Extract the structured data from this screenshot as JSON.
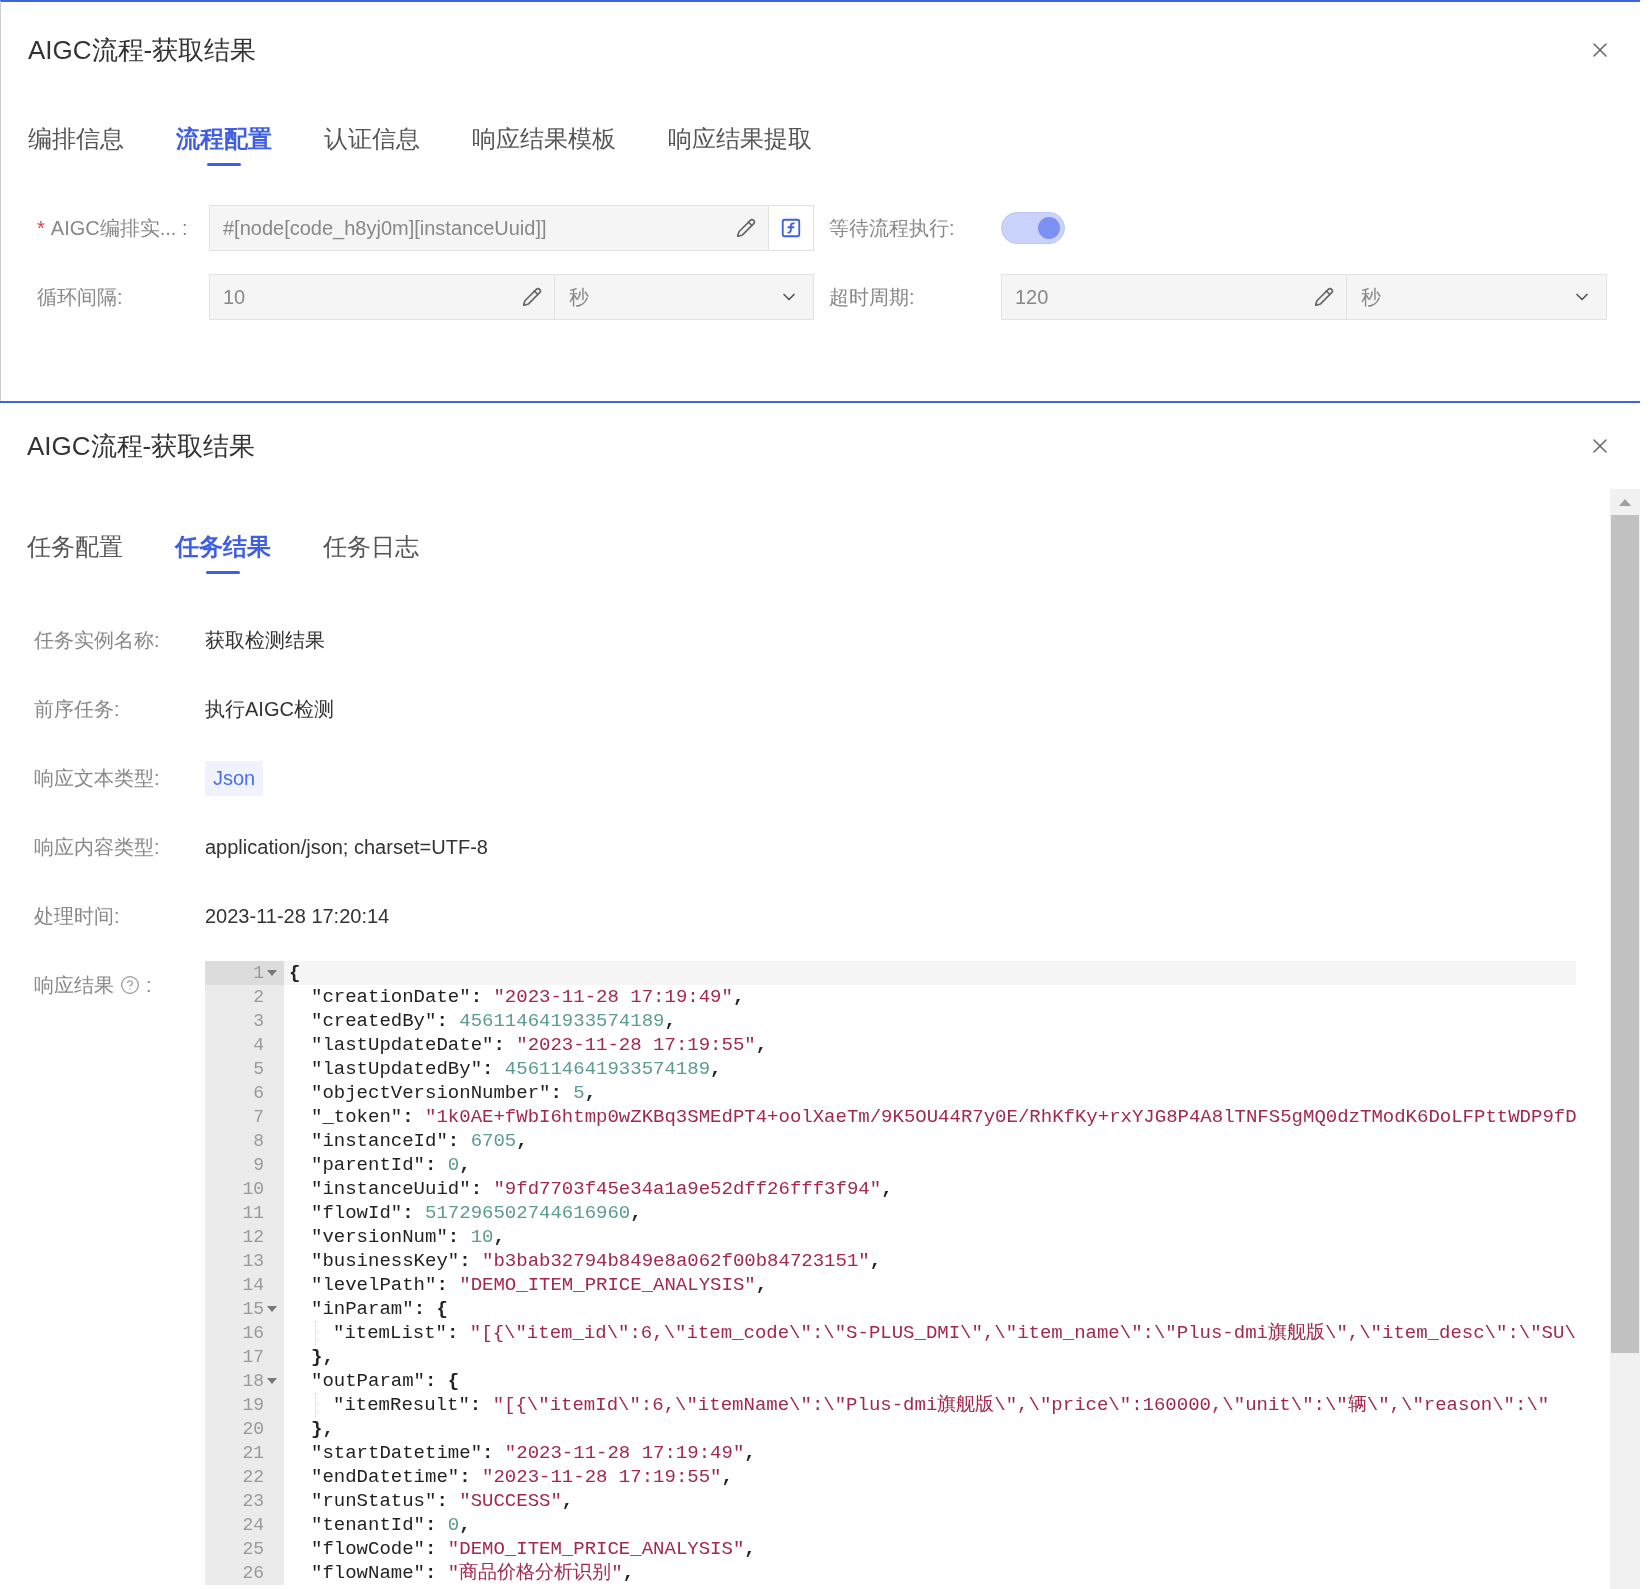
{
  "config_dialog": {
    "title": "AIGC流程-获取结果",
    "tabs": [
      {
        "label": "编排信息",
        "selected": false
      },
      {
        "label": "流程配置",
        "selected": true
      },
      {
        "label": "认证信息",
        "selected": false
      },
      {
        "label": "响应结果模板",
        "selected": false
      },
      {
        "label": "响应结果提取",
        "selected": false
      }
    ],
    "fields": [
      {
        "kind": "expression",
        "required_mark": "*",
        "label": "AIGC编排实... :",
        "value": "#[node[code_h8yj0m][instanceUuid]]"
      },
      {
        "kind": "toggle",
        "label": "等待流程执行:",
        "on": true
      },
      {
        "kind": "number_unit",
        "label": "循环间隔:",
        "value": "10",
        "unit": "秒"
      },
      {
        "kind": "number_unit",
        "label": "超时周期:",
        "value": "120",
        "unit": "秒"
      }
    ]
  },
  "result_dialog": {
    "title": "AIGC流程-获取结果",
    "tabs": [
      {
        "label": "任务配置",
        "selected": false
      },
      {
        "label": "任务结果",
        "selected": true
      },
      {
        "label": "任务日志",
        "selected": false
      }
    ],
    "info": [
      {
        "kind": "text",
        "label": "任务实例名称:",
        "value": "获取检测结果"
      },
      {
        "kind": "text",
        "label": "前序任务:",
        "value": "执行AIGC检测"
      },
      {
        "kind": "tag",
        "label": "响应文本类型:",
        "value": "Json"
      },
      {
        "kind": "text",
        "label": "响应内容类型:",
        "value": "application/json; charset=UTF-8"
      },
      {
        "kind": "text",
        "label": "处理时间:",
        "value": "2023-11-28 17:20:14"
      }
    ],
    "response": {
      "label": "响应结果",
      "colon": ":",
      "lines": [
        {
          "number": "1",
          "fold": true,
          "active": true,
          "tokens": [
            {
              "kind": "punct",
              "text": "{"
            }
          ],
          "children": [
            {
              "number": "2",
              "fold": false,
              "active": false,
              "tokens": [
                {
                  "kind": "key",
                  "text": "\"creationDate\""
                },
                {
                  "kind": "punct",
                  "text": ": "
                },
                {
                  "kind": "string",
                  "text": "\"2023-11-28 17:19:49\""
                },
                {
                  "kind": "punct",
                  "text": ","
                }
              ]
            },
            {
              "number": "3",
              "fold": false,
              "active": false,
              "tokens": [
                {
                  "kind": "key",
                  "text": "\"createdBy\""
                },
                {
                  "kind": "punct",
                  "text": ": "
                },
                {
                  "kind": "number",
                  "text": "456114641933574189"
                },
                {
                  "kind": "punct",
                  "text": ","
                }
              ]
            },
            {
              "number": "4",
              "fold": false,
              "active": false,
              "tokens": [
                {
                  "kind": "key",
                  "text": "\"lastUpdateDate\""
                },
                {
                  "kind": "punct",
                  "text": ": "
                },
                {
                  "kind": "string",
                  "text": "\"2023-11-28 17:19:55\""
                },
                {
                  "kind": "punct",
                  "text": ","
                }
              ]
            },
            {
              "number": "5",
              "fold": false,
              "active": false,
              "tokens": [
                {
                  "kind": "key",
                  "text": "\"lastUpdatedBy\""
                },
                {
                  "kind": "punct",
                  "text": ": "
                },
                {
                  "kind": "number",
                  "text": "456114641933574189"
                },
                {
                  "kind": "punct",
                  "text": ","
                }
              ]
            },
            {
              "number": "6",
              "fold": false,
              "active": false,
              "tokens": [
                {
                  "kind": "key",
                  "text": "\"objectVersionNumber\""
                },
                {
                  "kind": "punct",
                  "text": ": "
                },
                {
                  "kind": "number",
                  "text": "5"
                },
                {
                  "kind": "punct",
                  "text": ","
                }
              ]
            },
            {
              "number": "7",
              "fold": false,
              "active": false,
              "tokens": [
                {
                  "kind": "key",
                  "text": "\"_token\""
                },
                {
                  "kind": "punct",
                  "text": ": "
                },
                {
                  "kind": "string",
                  "text": "\"1k0AE+fWbI6htmp0wZKBq3SMEdPT4+oolXaeTm/9K5OU44R7y0E/RhKfKy+rxYJG8P4A8lTNFS5gMQ0dzTModK6DoLFPttWDP9fD"
                }
              ]
            },
            {
              "number": "8",
              "fold": false,
              "active": false,
              "tokens": [
                {
                  "kind": "key",
                  "text": "\"instanceId\""
                },
                {
                  "kind": "punct",
                  "text": ": "
                },
                {
                  "kind": "number",
                  "text": "6705"
                },
                {
                  "kind": "punct",
                  "text": ","
                }
              ]
            },
            {
              "number": "9",
              "fold": false,
              "active": false,
              "tokens": [
                {
                  "kind": "key",
                  "text": "\"parentId\""
                },
                {
                  "kind": "punct",
                  "text": ": "
                },
                {
                  "kind": "number",
                  "text": "0"
                },
                {
                  "kind": "punct",
                  "text": ","
                }
              ]
            },
            {
              "number": "10",
              "fold": false,
              "active": false,
              "tokens": [
                {
                  "kind": "key",
                  "text": "\"instanceUuid\""
                },
                {
                  "kind": "punct",
                  "text": ": "
                },
                {
                  "kind": "string",
                  "text": "\"9fd7703f45e34a1a9e52dff26fff3f94\""
                },
                {
                  "kind": "punct",
                  "text": ","
                }
              ]
            },
            {
              "number": "11",
              "fold": false,
              "active": false,
              "tokens": [
                {
                  "kind": "key",
                  "text": "\"flowId\""
                },
                {
                  "kind": "punct",
                  "text": ": "
                },
                {
                  "kind": "number",
                  "text": "517296502744616960"
                },
                {
                  "kind": "punct",
                  "text": ","
                }
              ]
            },
            {
              "number": "12",
              "fold": false,
              "active": false,
              "tokens": [
                {
                  "kind": "key",
                  "text": "\"versionNum\""
                },
                {
                  "kind": "punct",
                  "text": ": "
                },
                {
                  "kind": "number",
                  "text": "10"
                },
                {
                  "kind": "punct",
                  "text": ","
                }
              ]
            },
            {
              "number": "13",
              "fold": false,
              "active": false,
              "tokens": [
                {
                  "kind": "key",
                  "text": "\"businessKey\""
                },
                {
                  "kind": "punct",
                  "text": ": "
                },
                {
                  "kind": "string",
                  "text": "\"b3bab32794b849e8a062f00b84723151\""
                },
                {
                  "kind": "punct",
                  "text": ","
                }
              ]
            },
            {
              "number": "14",
              "fold": false,
              "active": false,
              "tokens": [
                {
                  "kind": "key",
                  "text": "\"levelPath\""
                },
                {
                  "kind": "punct",
                  "text": ": "
                },
                {
                  "kind": "string",
                  "text": "\"DEMO_ITEM_PRICE_ANALYSIS\""
                },
                {
                  "kind": "punct",
                  "text": ","
                }
              ]
            },
            {
              "number": "15",
              "fold": true,
              "active": false,
              "tokens": [
                {
                  "kind": "key",
                  "text": "\"inParam\""
                },
                {
                  "kind": "punct",
                  "text": ": {"
                }
              ],
              "children": [
                {
                  "number": "16",
                  "fold": false,
                  "active": false,
                  "tokens": [
                    {
                      "kind": "key",
                      "text": "\"itemList\""
                    },
                    {
                      "kind": "punct",
                      "text": ": "
                    },
                    {
                      "kind": "string",
                      "text": "\"[{\\\"item_id\\\":6,\\\"item_code\\\":\\\"S-PLUS_DMI\\\",\\\"item_name\\\":\\\"Plus-dmi旗舰版\\\",\\\"item_desc\\\":\\\"SU\\"
                    }
                  ]
                }
              ]
            },
            {
              "number": "17",
              "fold": false,
              "active": false,
              "tokens": [
                {
                  "kind": "punct",
                  "text": "},"
                }
              ]
            },
            {
              "number": "18",
              "fold": true,
              "active": false,
              "tokens": [
                {
                  "kind": "key",
                  "text": "\"outParam\""
                },
                {
                  "kind": "punct",
                  "text": ": {"
                }
              ],
              "children": [
                {
                  "number": "19",
                  "fold": false,
                  "active": false,
                  "tokens": [
                    {
                      "kind": "key",
                      "text": "\"itemResult\""
                    },
                    {
                      "kind": "punct",
                      "text": ": "
                    },
                    {
                      "kind": "string",
                      "text": "\"[{\\\"itemId\\\":6,\\\"itemName\\\":\\\"Plus-dmi旗舰版\\\",\\\"price\\\":160000,\\\"unit\\\":\\\"辆\\\",\\\"reason\\\":\\\""
                    }
                  ]
                }
              ]
            },
            {
              "number": "20",
              "fold": false,
              "active": false,
              "tokens": [
                {
                  "kind": "punct",
                  "text": "},"
                }
              ]
            },
            {
              "number": "21",
              "fold": false,
              "active": false,
              "tokens": [
                {
                  "kind": "key",
                  "text": "\"startDatetime\""
                },
                {
                  "kind": "punct",
                  "text": ": "
                },
                {
                  "kind": "string",
                  "text": "\"2023-11-28 17:19:49\""
                },
                {
                  "kind": "punct",
                  "text": ","
                }
              ]
            },
            {
              "number": "22",
              "fold": false,
              "active": false,
              "tokens": [
                {
                  "kind": "key",
                  "text": "\"endDatetime\""
                },
                {
                  "kind": "punct",
                  "text": ": "
                },
                {
                  "kind": "string",
                  "text": "\"2023-11-28 17:19:55\""
                },
                {
                  "kind": "punct",
                  "text": ","
                }
              ]
            },
            {
              "number": "23",
              "fold": false,
              "active": false,
              "tokens": [
                {
                  "kind": "key",
                  "text": "\"runStatus\""
                },
                {
                  "kind": "punct",
                  "text": ": "
                },
                {
                  "kind": "string",
                  "text": "\"SUCCESS\""
                },
                {
                  "kind": "punct",
                  "text": ","
                }
              ]
            },
            {
              "number": "24",
              "fold": false,
              "active": false,
              "tokens": [
                {
                  "kind": "key",
                  "text": "\"tenantId\""
                },
                {
                  "kind": "punct",
                  "text": ": "
                },
                {
                  "kind": "number",
                  "text": "0"
                },
                {
                  "kind": "punct",
                  "text": ","
                }
              ]
            },
            {
              "number": "25",
              "fold": false,
              "active": false,
              "tokens": [
                {
                  "kind": "key",
                  "text": "\"flowCode\""
                },
                {
                  "kind": "punct",
                  "text": ": "
                },
                {
                  "kind": "string",
                  "text": "\"DEMO_ITEM_PRICE_ANALYSIS\""
                },
                {
                  "kind": "punct",
                  "text": ","
                }
              ]
            },
            {
              "number": "26",
              "fold": false,
              "active": false,
              "tokens": [
                {
                  "kind": "key",
                  "text": "\"flowName\""
                },
                {
                  "kind": "punct",
                  "text": ": "
                },
                {
                  "kind": "string",
                  "text": "\"商品价格分析识别\""
                },
                {
                  "kind": "punct",
                  "text": ","
                }
              ]
            }
          ]
        }
      ]
    }
  }
}
